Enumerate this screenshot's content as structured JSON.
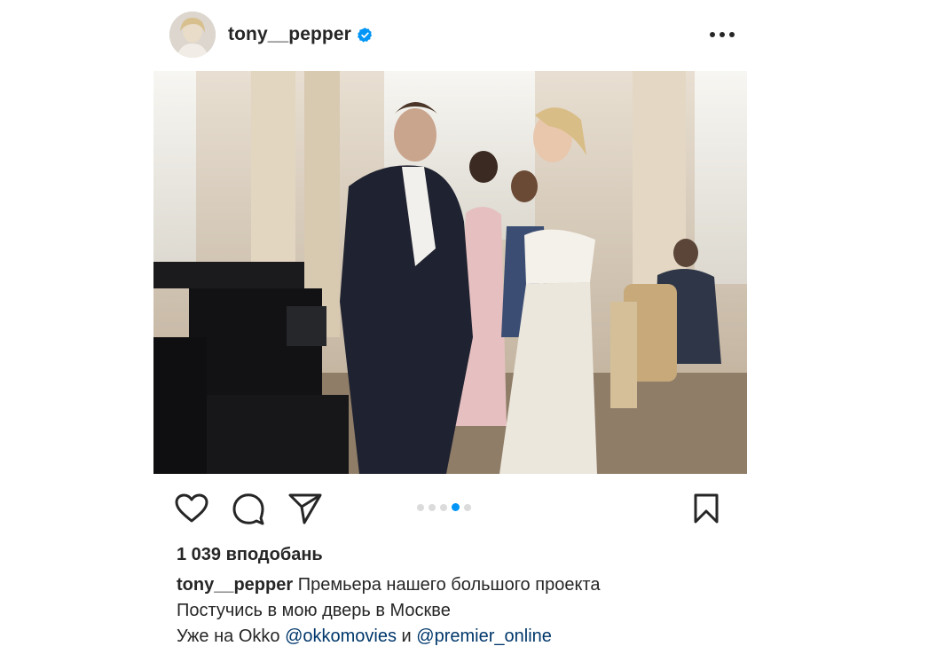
{
  "post": {
    "username": "tony__pepper",
    "verified": true,
    "likes": "1 039 вподобань",
    "carousel": {
      "count": 5,
      "active": 4
    },
    "caption": {
      "username": "tony__pepper",
      "line1": "Премьера нашего большого проекта",
      "line2": "Постучись в мою дверь в Москве",
      "line3_prefix": "Уже на Okko",
      "mention1": "@okkomovies",
      "conj": "и",
      "mention2": "@premier_online"
    }
  },
  "icons": {
    "like": "heart-outline-icon",
    "comment": "comment-icon",
    "share": "paper-plane-icon",
    "save": "bookmark-icon",
    "more": "more-horizontal-icon",
    "verified": "verified-badge-icon"
  },
  "colors": {
    "text": "#262626",
    "accent": "#0095f6",
    "mention": "#00376b",
    "dot_inactive": "#dbdbdb"
  }
}
